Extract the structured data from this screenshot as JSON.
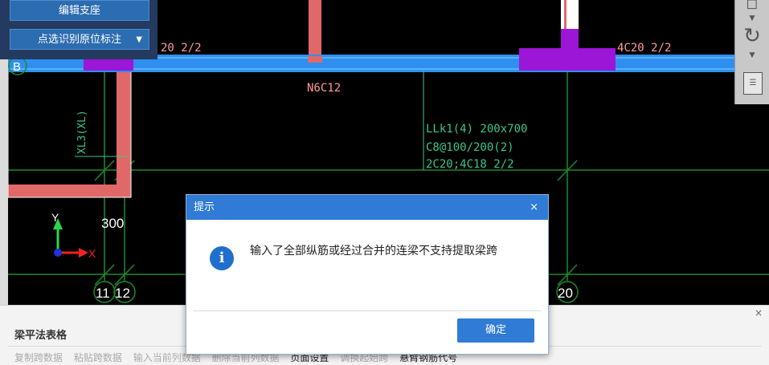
{
  "toolbar": {
    "edit_support_label": "编辑支座",
    "identify_label": "点选识别原位标注"
  },
  "cad": {
    "beam_label_top_left": "20 2/2",
    "beam_label_top_right": "4C20 2/2",
    "rebar_label": "N6C12",
    "beam_spec_line1": "LLk1(4) 200x700",
    "beam_spec_line2": "C8@100/200(2)",
    "beam_spec_line3": "2C20;4C18 2/2",
    "side_beam_label": "XL3(XL)",
    "axis_b": "B",
    "dim_300": "300",
    "axis_y": "Y",
    "axis_x": "X",
    "grid_11": "11",
    "grid_12": "12",
    "grid_20": "20"
  },
  "dialog": {
    "title": "提示",
    "close_glyph": "×",
    "message": "输入了全部纵筋或经过合并的连梁不支持提取梁跨",
    "ok_label": "确定"
  },
  "bottom_panel": {
    "title": "梁平法表格",
    "close_glyph": "×",
    "tools": [
      "复制跨数据",
      "粘贴跨数据",
      "输入当前列数据",
      "删除当前列数据",
      "页面设置",
      "调换起始跨",
      "悬臂钢筋代号"
    ]
  },
  "colors": {
    "canvas_bg": "#000000",
    "beam_blue": "#2f8ff0",
    "beam_pink": "#e06868",
    "support_purple": "#9b16d6",
    "grid_green": "#1e8a2e",
    "label_green": "#3cc68a",
    "dialog_blue": "#2f7bd6"
  }
}
